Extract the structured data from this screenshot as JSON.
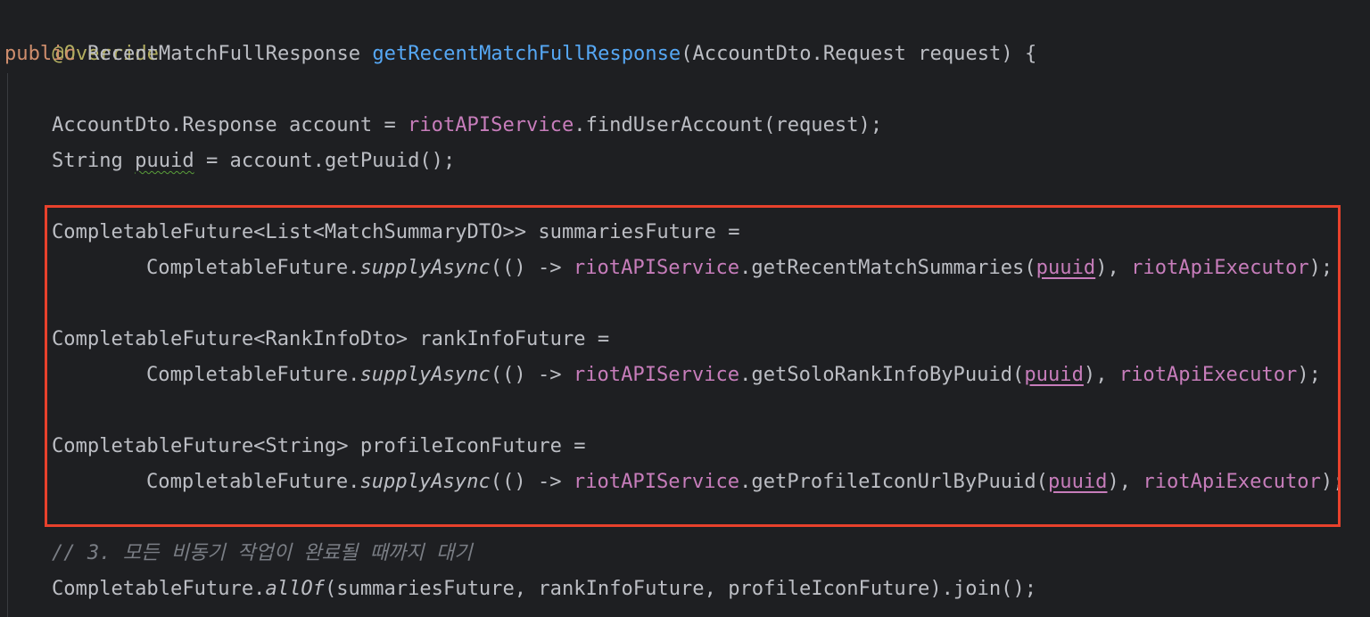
{
  "colors": {
    "background": "#1e1f22",
    "default_text": "#bcbec4",
    "annotation": "#b3ae60",
    "keyword": "#cf8e6d",
    "method_declaration": "#56a8f5",
    "field": "#c77dbb",
    "comment": "#7a7e85",
    "highlight_border": "#e8412c"
  },
  "code": {
    "annotation": "@Override",
    "signature": {
      "keyword": "public",
      "return_type": " RecentMatchFullResponse ",
      "method_name": "getRecentMatchFullResponse",
      "params": "(AccountDto.Request request) {"
    },
    "account_line": {
      "decl": "AccountDto.Response account = ",
      "field": "riotAPIService",
      "call": ".findUserAccount(request);"
    },
    "puuid_line": {
      "type": "String ",
      "var": "puuid",
      "rest": " = account.getPuuid();"
    },
    "summaries": {
      "decl": "CompletableFuture<List<MatchSummaryDTO>> summariesFuture =",
      "prefix": "CompletableFuture.",
      "static_method": "supplyAsync",
      "lambda": "(() -> ",
      "field": "riotAPIService",
      "call": ".getRecentMatchSummaries(",
      "arg": "puuid",
      "sep": "), ",
      "executor": "riotApiExecutor",
      "end": ");"
    },
    "rank": {
      "decl": "CompletableFuture<RankInfoDto> rankInfoFuture =",
      "prefix": "CompletableFuture.",
      "static_method": "supplyAsync",
      "lambda": "(() -> ",
      "field": "riotAPIService",
      "call": ".getSoloRankInfoByPuuid(",
      "arg": "puuid",
      "sep": "), ",
      "executor": "riotApiExecutor",
      "end": ");"
    },
    "profile": {
      "decl": "CompletableFuture<String> profileIconFuture =",
      "prefix": "CompletableFuture.",
      "static_method": "supplyAsync",
      "lambda": "(() -> ",
      "field": "riotAPIService",
      "call": ".getProfileIconUrlByPuuid(",
      "arg": "puuid",
      "sep": "), ",
      "executor": "riotApiExecutor",
      "end": ");"
    },
    "comment": "// 3. 모든 비동기 작업이 완료될 때까지 대기",
    "join_line": {
      "prefix": "CompletableFuture.",
      "static_method": "allOf",
      "rest": "(summariesFuture, rankInfoFuture, profileIconFuture).join();"
    }
  }
}
